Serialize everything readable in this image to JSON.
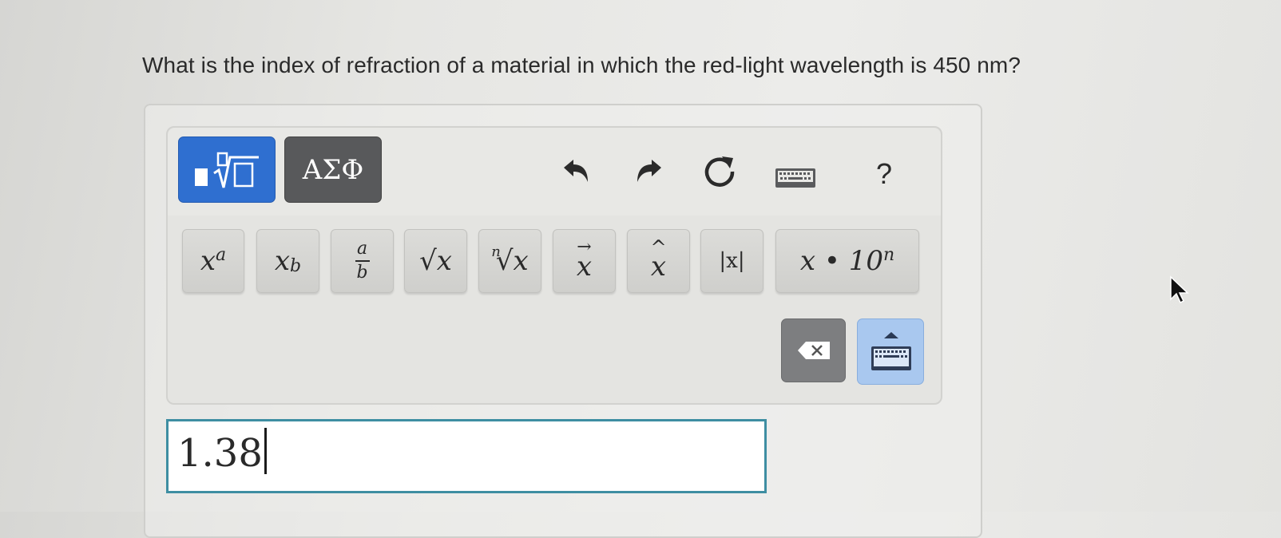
{
  "question": {
    "text": "What is the index of refraction of a material in which the red-light wavelength is 450 nm?"
  },
  "tabs": [
    {
      "name": "math",
      "icon": "math-template-icon",
      "selected": true,
      "color": "#2f6fd0"
    },
    {
      "name": "greek",
      "label": "ΑΣΦ",
      "selected": false,
      "color": "#58595b"
    }
  ],
  "toolbar": {
    "undo_icon": "undo-arrow-icon",
    "redo_icon": "redo-arrow-icon",
    "reset_icon": "reset-icon",
    "keyboard_icon": "keyboard-icon",
    "help_label": "?"
  },
  "keys": [
    {
      "base": "x",
      "sup": "a"
    },
    {
      "base": "x",
      "sub": "b"
    },
    {
      "num": "a",
      "den": "b"
    },
    {
      "label": "√x"
    },
    {
      "index": "n",
      "label": "√x"
    },
    {
      "label": "x",
      "accent": "vector"
    },
    {
      "label": "x",
      "accent": "hat"
    },
    {
      "label": "|x|"
    },
    {
      "label": "x • 10",
      "sup": "n"
    }
  ],
  "answer": {
    "value": "1.38"
  }
}
